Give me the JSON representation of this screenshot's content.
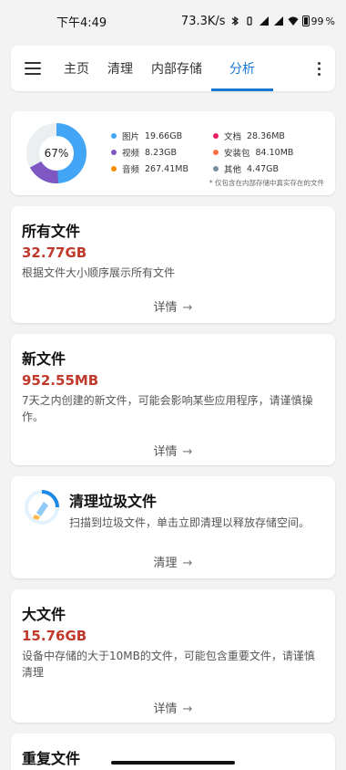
{
  "status_bar": {
    "time": "下午4:49",
    "net_speed": "73.3K/s",
    "battery": "99"
  },
  "tabs": [
    {
      "label": "主页"
    },
    {
      "label": "清理"
    },
    {
      "label": "内部存储"
    },
    {
      "label": "分析",
      "active": true
    }
  ],
  "summary": {
    "percent_label": "67%",
    "used_fraction": 0.67,
    "legend": [
      {
        "name": "图片",
        "size": "19.66GB",
        "color": "#42a5f5"
      },
      {
        "name": "文档",
        "size": "28.36MB",
        "color": "#e91e63"
      },
      {
        "name": "视频",
        "size": "8.23GB",
        "color": "#7e57c2"
      },
      {
        "name": "安装包",
        "size": "84.10MB",
        "color": "#ff7043"
      },
      {
        "name": "音频",
        "size": "267.41MB",
        "color": "#fb8c00"
      },
      {
        "name": "其他",
        "size": "4.47GB",
        "color": "#78909c"
      }
    ],
    "note": "* 仅包含在内部存储中真实存在的文件"
  },
  "cards": {
    "all_files": {
      "title": "所有文件",
      "size": "32.77GB",
      "desc": "根据文件大小顺序展示所有文件",
      "link": "详情"
    },
    "new_files": {
      "title": "新文件",
      "size": "952.55MB",
      "desc": "7天之内创建的新文件，可能会影响某些应用程序，请谨慎操作。",
      "link": "详情"
    },
    "cleanup": {
      "title": "清理垃圾文件",
      "desc": "扫描到垃圾文件，单击立即清理以释放存储空间。",
      "link": "清理"
    },
    "big_files": {
      "title": "大文件",
      "size": "15.76GB",
      "desc": "设备中存储的大于10MB的文件，可能包含重要文件，请谨慎清理",
      "link": "详情"
    },
    "dup_files": {
      "title": "重复文件"
    }
  }
}
